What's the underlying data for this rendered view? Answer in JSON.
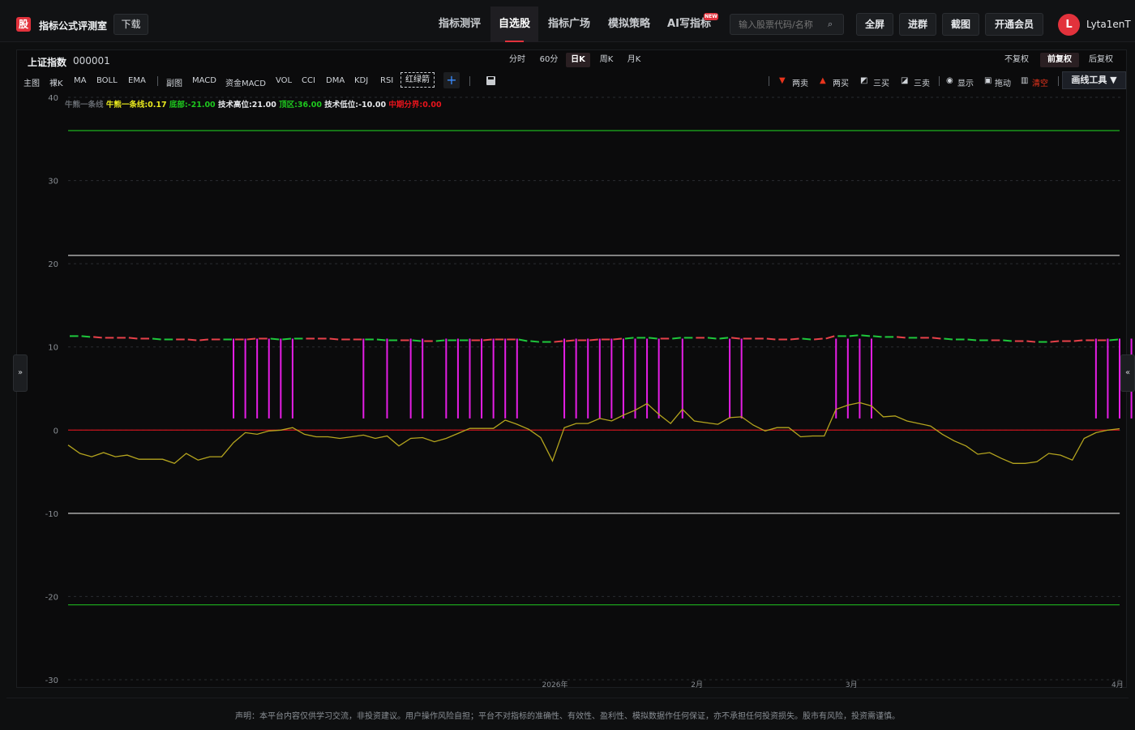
{
  "header": {
    "logo_char": "股",
    "brand": "指标公式评测室",
    "download": "下载",
    "nav": [
      {
        "label": "指标测评",
        "active": false
      },
      {
        "label": "自选股",
        "active": true
      },
      {
        "label": "指标广场",
        "active": false
      },
      {
        "label": "模拟策略",
        "active": false
      },
      {
        "label": "AI写指标",
        "active": false
      }
    ],
    "new_badge": "NEW",
    "search_placeholder": "输入股票代码/名称",
    "buttons": [
      "全屏",
      "进群",
      "截图",
      "开通会员"
    ],
    "avatar_letter": "L",
    "username": "Lyta1enT"
  },
  "stock": {
    "name": "上证指数",
    "code": "000001"
  },
  "periods": [
    {
      "label": "分时",
      "active": false
    },
    {
      "label": "60分",
      "active": false
    },
    {
      "label": "日K",
      "active": true
    },
    {
      "label": "周K",
      "active": false
    },
    {
      "label": "月K",
      "active": false
    }
  ],
  "adjust": [
    {
      "label": "不复权",
      "active": false
    },
    {
      "label": "前复权",
      "active": true
    },
    {
      "label": "后复权",
      "active": false
    }
  ],
  "indicators_main": [
    "主图",
    "裸K",
    "MA",
    "BOLL",
    "EMA"
  ],
  "indicators_sub": [
    "副图",
    "MACD",
    "资金MACD",
    "VOL",
    "CCI",
    "DMA",
    "KDJ",
    "RSI"
  ],
  "indicator_active": "红绿箭",
  "right_tools": [
    {
      "label": "两卖",
      "icon": "down-triangle-icon",
      "color": "#e8341c"
    },
    {
      "label": "两买",
      "icon": "up-triangle-icon",
      "color": "#e8341c"
    },
    {
      "label": "三买",
      "icon": "chart-up-icon",
      "color": "#cfd3d8"
    },
    {
      "label": "三卖",
      "icon": "chart-down-icon",
      "color": "#cfd3d8"
    },
    {
      "label": "显示",
      "icon": "eye-icon",
      "color": "#cfd3d8"
    },
    {
      "label": "拖动",
      "icon": "lock-icon",
      "color": "#cfd3d8"
    },
    {
      "label": "清空",
      "icon": "trash-icon",
      "color": "#e8341c"
    }
  ],
  "draw_tool": "画线工具 ▼",
  "legend": [
    {
      "text": "牛熊一条线",
      "color": "#666a70"
    },
    {
      "text": "牛熊一条线:0.17",
      "color": "#e8e81e"
    },
    {
      "text": "底部:-21.00",
      "color": "#1ec81e"
    },
    {
      "text": "技术高位:21.00",
      "color": "#e6e8eb"
    },
    {
      "text": "顶区:36.00",
      "color": "#1ec81e"
    },
    {
      "text": "技术低位:-10.00",
      "color": "#e6e8eb"
    },
    {
      "text": "中期分界:0.00",
      "color": "#e8141c"
    }
  ],
  "side_tabs": {
    "left": "»",
    "right": "«"
  },
  "disclaimer": "声明：本平台内容仅供学习交流，非投资建议。用户操作风险自担；平台不对指标的准确性、有效性、盈利性、模拟数据作任何保证，亦不承担任何投资损失。股市有风险，投资需谨慎。",
  "chart_data": {
    "type": "line",
    "ylim": [
      -30,
      40
    ],
    "y_ticks": [
      40,
      30,
      20,
      10,
      0,
      -10,
      -20,
      -30
    ],
    "x_ticks": [
      "2026年",
      "2月",
      "3月",
      "4月"
    ],
    "hlines": [
      {
        "value": 36,
        "color": "#1eb41e",
        "name": "顶区"
      },
      {
        "value": 21,
        "color": "#c8c8c8",
        "name": "技术高位"
      },
      {
        "value": 0,
        "color": "#c8141c",
        "name": "中期分界"
      },
      {
        "value": -10,
        "color": "#c8c8c8",
        "name": "技术低位"
      },
      {
        "value": -21,
        "color": "#1eb41e",
        "name": "底部"
      }
    ],
    "bull_bear_line": [
      -1.8,
      -2.8,
      -3.2,
      -2.7,
      -3.2,
      -3.0,
      -3.5,
      -3.5,
      -3.5,
      -4.0,
      -2.8,
      -3.6,
      -3.2,
      -3.2,
      -1.5,
      -0.3,
      -0.5,
      -0.1,
      0.0,
      0.3,
      -0.5,
      -0.8,
      -0.8,
      -1.0,
      -0.8,
      -0.6,
      -1.0,
      -0.7,
      -1.9,
      -1.0,
      -0.9,
      -1.4,
      -1.0,
      -0.4,
      0.2,
      0.2,
      0.2,
      1.2,
      0.7,
      0.1,
      -0.9,
      -3.7,
      0.3,
      0.8,
      0.8,
      1.4,
      1.1,
      1.8,
      2.4,
      3.2,
      1.9,
      0.8,
      2.5,
      1.1,
      0.9,
      0.7,
      1.5,
      1.6,
      0.6,
      -0.1,
      0.3,
      0.3,
      -0.8,
      -0.7,
      -0.7,
      2.5,
      3.0,
      3.3,
      2.9,
      1.6,
      1.7,
      1.1,
      0.8,
      0.5,
      -0.5,
      -1.3,
      -1.9,
      -2.9,
      -2.7,
      -3.4,
      -4.0,
      -4.0,
      -3.8,
      -2.8,
      -3.0,
      -3.6,
      -1.0,
      -0.3,
      0.0,
      0.17
    ],
    "dashed_line": [
      11.3,
      11.3,
      11.2,
      11.1,
      11.1,
      11.1,
      11.0,
      11.0,
      10.9,
      10.9,
      10.9,
      10.8,
      10.9,
      10.9,
      10.9,
      10.9,
      11.0,
      11.0,
      10.9,
      11.0,
      11.0,
      11.0,
      11.0,
      10.9,
      10.9,
      10.9,
      10.9,
      10.8,
      10.8,
      10.8,
      10.7,
      10.7,
      10.8,
      10.8,
      10.8,
      10.8,
      10.9,
      10.9,
      10.9,
      10.7,
      10.6,
      10.6,
      10.7,
      10.8,
      10.8,
      10.9,
      10.9,
      11.0,
      11.1,
      11.1,
      11.0,
      11.0,
      11.1,
      11.1,
      11.1,
      11.0,
      11.1,
      11.0,
      11.0,
      11.0,
      10.9,
      10.9,
      11.0,
      10.9,
      11.0,
      11.3,
      11.3,
      11.4,
      11.3,
      11.2,
      11.2,
      11.1,
      11.1,
      11.1,
      11.0,
      10.9,
      10.9,
      10.8,
      10.8,
      10.8,
      10.7,
      10.7,
      10.6,
      10.6,
      10.7,
      10.7,
      10.8,
      10.8,
      10.8,
      10.9
    ],
    "dashed_colors": "ggrrrrrggrrrrgrrrgggrrrrrgggrgrgggrrrrgggrrrrrrgggrggrggrrrrrrgrrgggggrgrrggggrgrrgrrrrrgr",
    "stems_at": [
      14,
      15,
      16,
      17,
      18,
      19,
      25,
      27,
      29,
      30,
      32,
      33,
      34,
      35,
      36,
      37,
      38,
      42,
      43,
      44,
      45,
      46,
      47,
      48,
      49,
      50,
      52,
      56,
      57,
      65,
      66,
      67,
      68,
      87,
      88,
      89,
      90
    ],
    "stem_top": 11.0,
    "stem_bottom": 1.4
  }
}
